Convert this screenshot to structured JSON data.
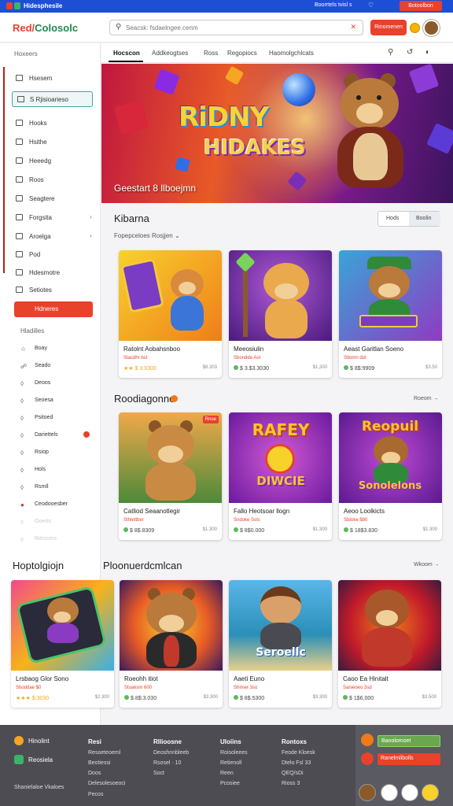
{
  "colors": {
    "accent": "#e8412c",
    "topbar": "#1d4fd6",
    "footer": "#4c4c52",
    "success": "#5cb85c"
  },
  "topbar": {
    "title": "Hidesphesile",
    "link": "Boorrtels tvisl s",
    "cta": "Botoolbon"
  },
  "header": {
    "brand_red": "Red/",
    "brand_green": "Colosolc",
    "search": {
      "placeholder": "Seacsk: fsdaelngee.cenm"
    },
    "button": "Rinomenen"
  },
  "sidebar": {
    "title": "Hoxeers",
    "items": [
      {
        "label": "Hsesem",
        "icon": "home-icon"
      },
      {
        "label": "S Rjisioarieso",
        "icon": "search-icon"
      },
      {
        "label": "Hooks",
        "icon": "book-icon"
      },
      {
        "label": "Hsithe",
        "icon": "document-icon"
      },
      {
        "label": "Heeedg",
        "icon": "bookmark-icon"
      },
      {
        "label": "Roos",
        "icon": "grid-icon"
      },
      {
        "label": "Seagtere",
        "icon": "chart-icon"
      },
      {
        "label": "Forgsita",
        "icon": "folder-icon"
      },
      {
        "label": "Aroelga",
        "icon": "tag-icon"
      },
      {
        "label": "Pod",
        "icon": "list-icon"
      },
      {
        "label": "Hdesmotre",
        "icon": "calendar-icon"
      },
      {
        "label": "Setiotes",
        "icon": "gear-icon"
      },
      {
        "label": "Hdneres",
        "icon": "heart-icon"
      }
    ],
    "sub_title": "Hladilles",
    "sub_items": [
      {
        "label": "Boay",
        "icon": "star-icon"
      },
      {
        "label": "Seado",
        "icon": "cart-icon"
      },
      {
        "label": "Deoos",
        "icon": "gift-icon"
      },
      {
        "label": "Seoesa",
        "icon": "bell-icon"
      },
      {
        "label": "Psitoed",
        "icon": "chat-icon"
      },
      {
        "label": "Dariettels",
        "icon": "user-icon"
      },
      {
        "label": "Rsiop",
        "icon": "trophy-icon"
      },
      {
        "label": "Hols",
        "icon": "clock-icon"
      },
      {
        "label": "Rsmll",
        "icon": "play-icon"
      },
      {
        "label": "Ceodooesber",
        "icon": "avatar-icon"
      },
      {
        "label": "Ooerts",
        "icon": "info-icon"
      },
      {
        "label": "Rdrosms",
        "icon": "settings-icon"
      }
    ]
  },
  "tabs": [
    "Hocscon",
    "Addkeogtses",
    "Ross",
    "Regopiocs",
    "Haomolgchlcats"
  ],
  "hero": {
    "title": "RiDNY",
    "subtitle": "HIDAKES",
    "caption": "Geestart 8 llboejmn"
  },
  "section1": {
    "title": "Kibarna",
    "subtitle": "Fopepceloes Rosjjen",
    "segments": [
      "Hods",
      "Boolin"
    ],
    "cards": [
      {
        "title": "Ratolnt Aobahsnboo",
        "sub": "Stacdhr bst",
        "price": "★★ $ 3.9300",
        "meta": "$8.303"
      },
      {
        "title": "Meeosiulin",
        "sub": "Sbondde Aol",
        "price": "$ 3.$3.3030",
        "meta": "$1,300"
      },
      {
        "title": "Aeast Garitlan Soeno",
        "sub": "Stlomn dol",
        "price": "$ 8$:9909",
        "meta": "$3.50"
      }
    ]
  },
  "section2": {
    "title": "Roodiagonno",
    "view_all": "Roeom →",
    "cards": [
      {
        "title": "Catliod Seaanotlegir",
        "sub": "Sthlettber",
        "price": "$ 8$.8309",
        "meta": "$1.300",
        "tag": "Rnoe",
        "art": ""
      },
      {
        "title": "Fallo Heotsoar llogn",
        "sub": "Sndoke Sols",
        "price": "$ 8$0.000",
        "meta": "$1.300",
        "art": "RAFEY",
        "art2": "DIWCIE"
      },
      {
        "title": "Aeoo Loolkicts",
        "sub": "Sbtoke $90",
        "price": "$ 18$3.830",
        "meta": "$1.300",
        "art": "Reopuil",
        "art2": "Sonolelons"
      }
    ]
  },
  "section3": {
    "title_a": "Hoptolgiojn",
    "title_b": "Ploonuerdcmlcan",
    "view_all": "Wkoom →",
    "cards": [
      {
        "title": "Lrsbaog Glor Sono",
        "sub": "Sboddae $0",
        "price": "★★★ $:3030",
        "meta": "$2.300"
      },
      {
        "title": "Roeohh itiot",
        "sub": "Stoaksm 600",
        "price": "$ 8$:3.030",
        "meta": "$3.300"
      },
      {
        "title": "Aaeti Euno",
        "sub": "Shimer 3so",
        "price": "$ 8$.5300",
        "meta": "$3.300",
        "art": "Seroellc"
      },
      {
        "title": "Caoo Ea Hinitalt",
        "sub": "Sanieoeo 3sd",
        "price": "$ 1$6,000",
        "meta": "$3.500"
      }
    ]
  },
  "footer": {
    "brand_a": "Hinolint",
    "brand_b": "Reosiela",
    "columns": [
      {
        "heading": "Resi",
        "links": [
          "Resoeteoeml",
          "Beotiessi",
          "Doos",
          "Delesolesoeoci",
          "Pecos"
        ]
      },
      {
        "heading": "Rllioosne",
        "links": [
          "Deoshnnbleeb",
          "Rsosel · 10",
          "Soct"
        ]
      },
      {
        "heading": "Uloiins",
        "links": [
          "Roisoleees",
          "Retienoll",
          "Reen",
          "Pcosiee"
        ]
      },
      {
        "heading": "Rontoxs",
        "links": [
          "Feode Kloesk",
          "Dtelo Fsl 33",
          "QEQ/sDi",
          "Rioss 3"
        ]
      }
    ],
    "copyright": "Shanielaloe Vkaloes",
    "btn_green": "Baoolomoet",
    "btn_red": "Ranelmlibolls"
  }
}
